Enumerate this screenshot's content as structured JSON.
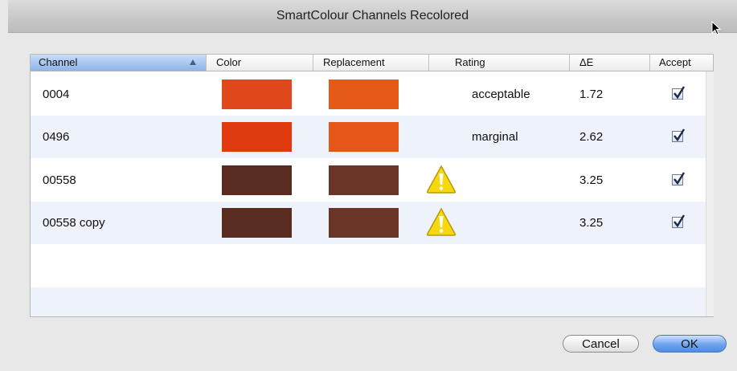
{
  "window": {
    "title": "SmartColour Channels Recolored"
  },
  "table": {
    "columns": [
      "Channel",
      "Color",
      "Replacement",
      "Rating",
      "ΔE",
      "Accept"
    ],
    "sorted_column": "Channel",
    "rows": [
      {
        "channel": "0004",
        "color": "#e0471b",
        "replacement": "#e65a17",
        "rating": "acceptable",
        "warning": false,
        "delta_e": "1.72",
        "accept": true
      },
      {
        "channel": "0496",
        "color": "#e03a10",
        "replacement": "#e55718",
        "rating": "marginal",
        "warning": false,
        "delta_e": "2.62",
        "accept": true
      },
      {
        "channel": "00558",
        "color": "#5a2b20",
        "replacement": "#6a3427",
        "rating": "",
        "warning": true,
        "delta_e": "3.25",
        "accept": true
      },
      {
        "channel": "00558 copy",
        "color": "#5a2b20",
        "replacement": "#6a3427",
        "rating": "",
        "warning": true,
        "delta_e": "3.25",
        "accept": true
      }
    ]
  },
  "buttons": {
    "cancel": "Cancel",
    "ok": "OK"
  }
}
